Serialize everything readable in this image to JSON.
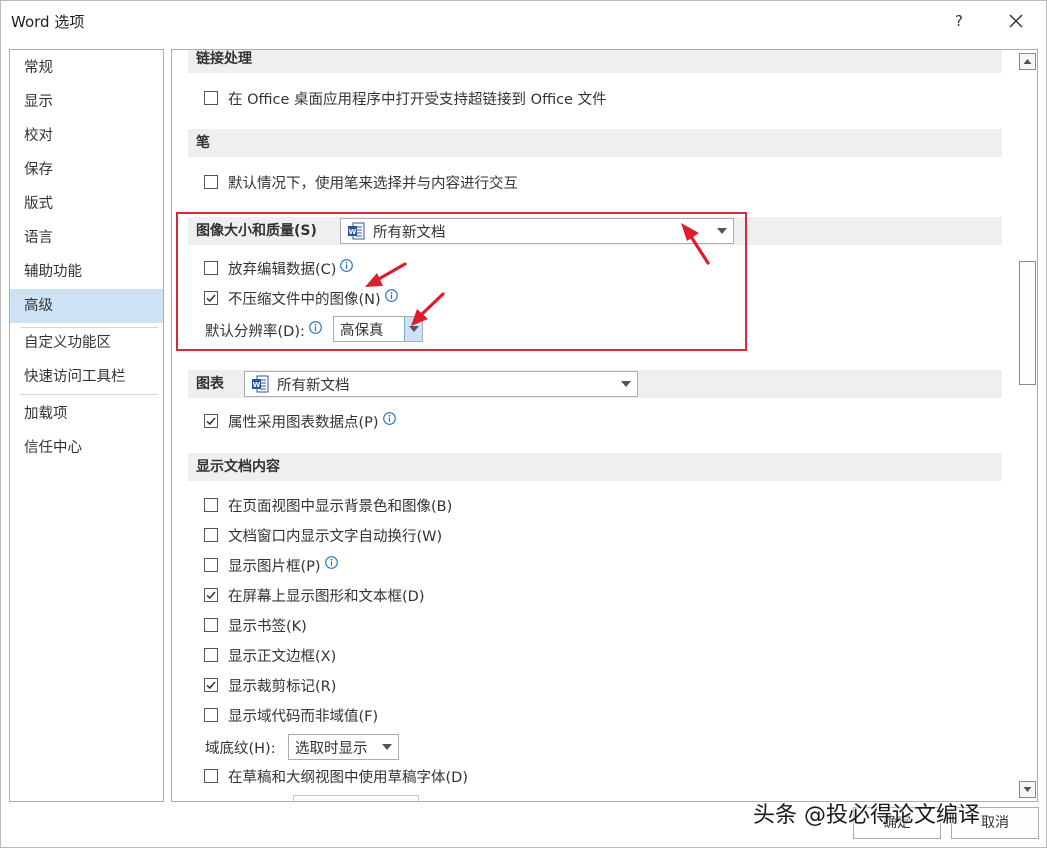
{
  "window": {
    "title": "Word 选项",
    "help": "?"
  },
  "sidebar": {
    "items": [
      {
        "label": "常规"
      },
      {
        "label": "显示"
      },
      {
        "label": "校对"
      },
      {
        "label": "保存"
      },
      {
        "label": "版式"
      },
      {
        "label": "语言"
      },
      {
        "label": "辅助功能"
      },
      {
        "label": "高级",
        "selected": true
      },
      {
        "label": "自定义功能区"
      },
      {
        "label": "快速访问工具栏"
      },
      {
        "label": "加载项"
      },
      {
        "label": "信任中心"
      }
    ]
  },
  "sections": {
    "hyperlink": {
      "header": "链接处理",
      "option1": "在 Office 桌面应用程序中打开受支持超链接到 Office 文件"
    },
    "pen": {
      "header": "笔",
      "option1": "默认情况下，使用笔来选择并与内容进行交互"
    },
    "image_size": {
      "header": "图像大小和质量(S)",
      "doc_select": "所有新文档",
      "discard_edit": "放弃编辑数据(C)",
      "no_compress": "不压缩文件中的图像(N)",
      "resolution_label": "默认分辨率(D):",
      "resolution_value": "高保真"
    },
    "chart": {
      "header": "图表",
      "doc_select": "所有新文档",
      "option1": "属性采用图表数据点(P)"
    },
    "display": {
      "header": "显示文档内容",
      "options": [
        {
          "label": "在页面视图中显示背景色和图像(B)",
          "checked": false
        },
        {
          "label": "文档窗口内显示文字自动换行(W)",
          "checked": false
        },
        {
          "label": "显示图片框(P)",
          "checked": false
        },
        {
          "label": "在屏幕上显示图形和文本框(D)",
          "checked": true
        },
        {
          "label": "显示书签(K)",
          "checked": false
        },
        {
          "label": "显示正文边框(X)",
          "checked": false
        },
        {
          "label": "显示裁剪标记(R)",
          "checked": true
        },
        {
          "label": "显示域代码而非域值(F)",
          "checked": false
        }
      ],
      "field_shading_label": "域底纹(H):",
      "field_shading_value": "选取时显示",
      "draft_font": "在草稿和大纲视图中使用草稿字体(D)"
    }
  },
  "footer": {
    "ok": "确定",
    "cancel": "取消"
  },
  "watermark": "头条 @投必得论文编译",
  "colors": {
    "highlight": "#d9283a",
    "selected_nav": "#cde3f5",
    "section_bg": "#efefef",
    "info_blue": "#1e6fb8"
  }
}
